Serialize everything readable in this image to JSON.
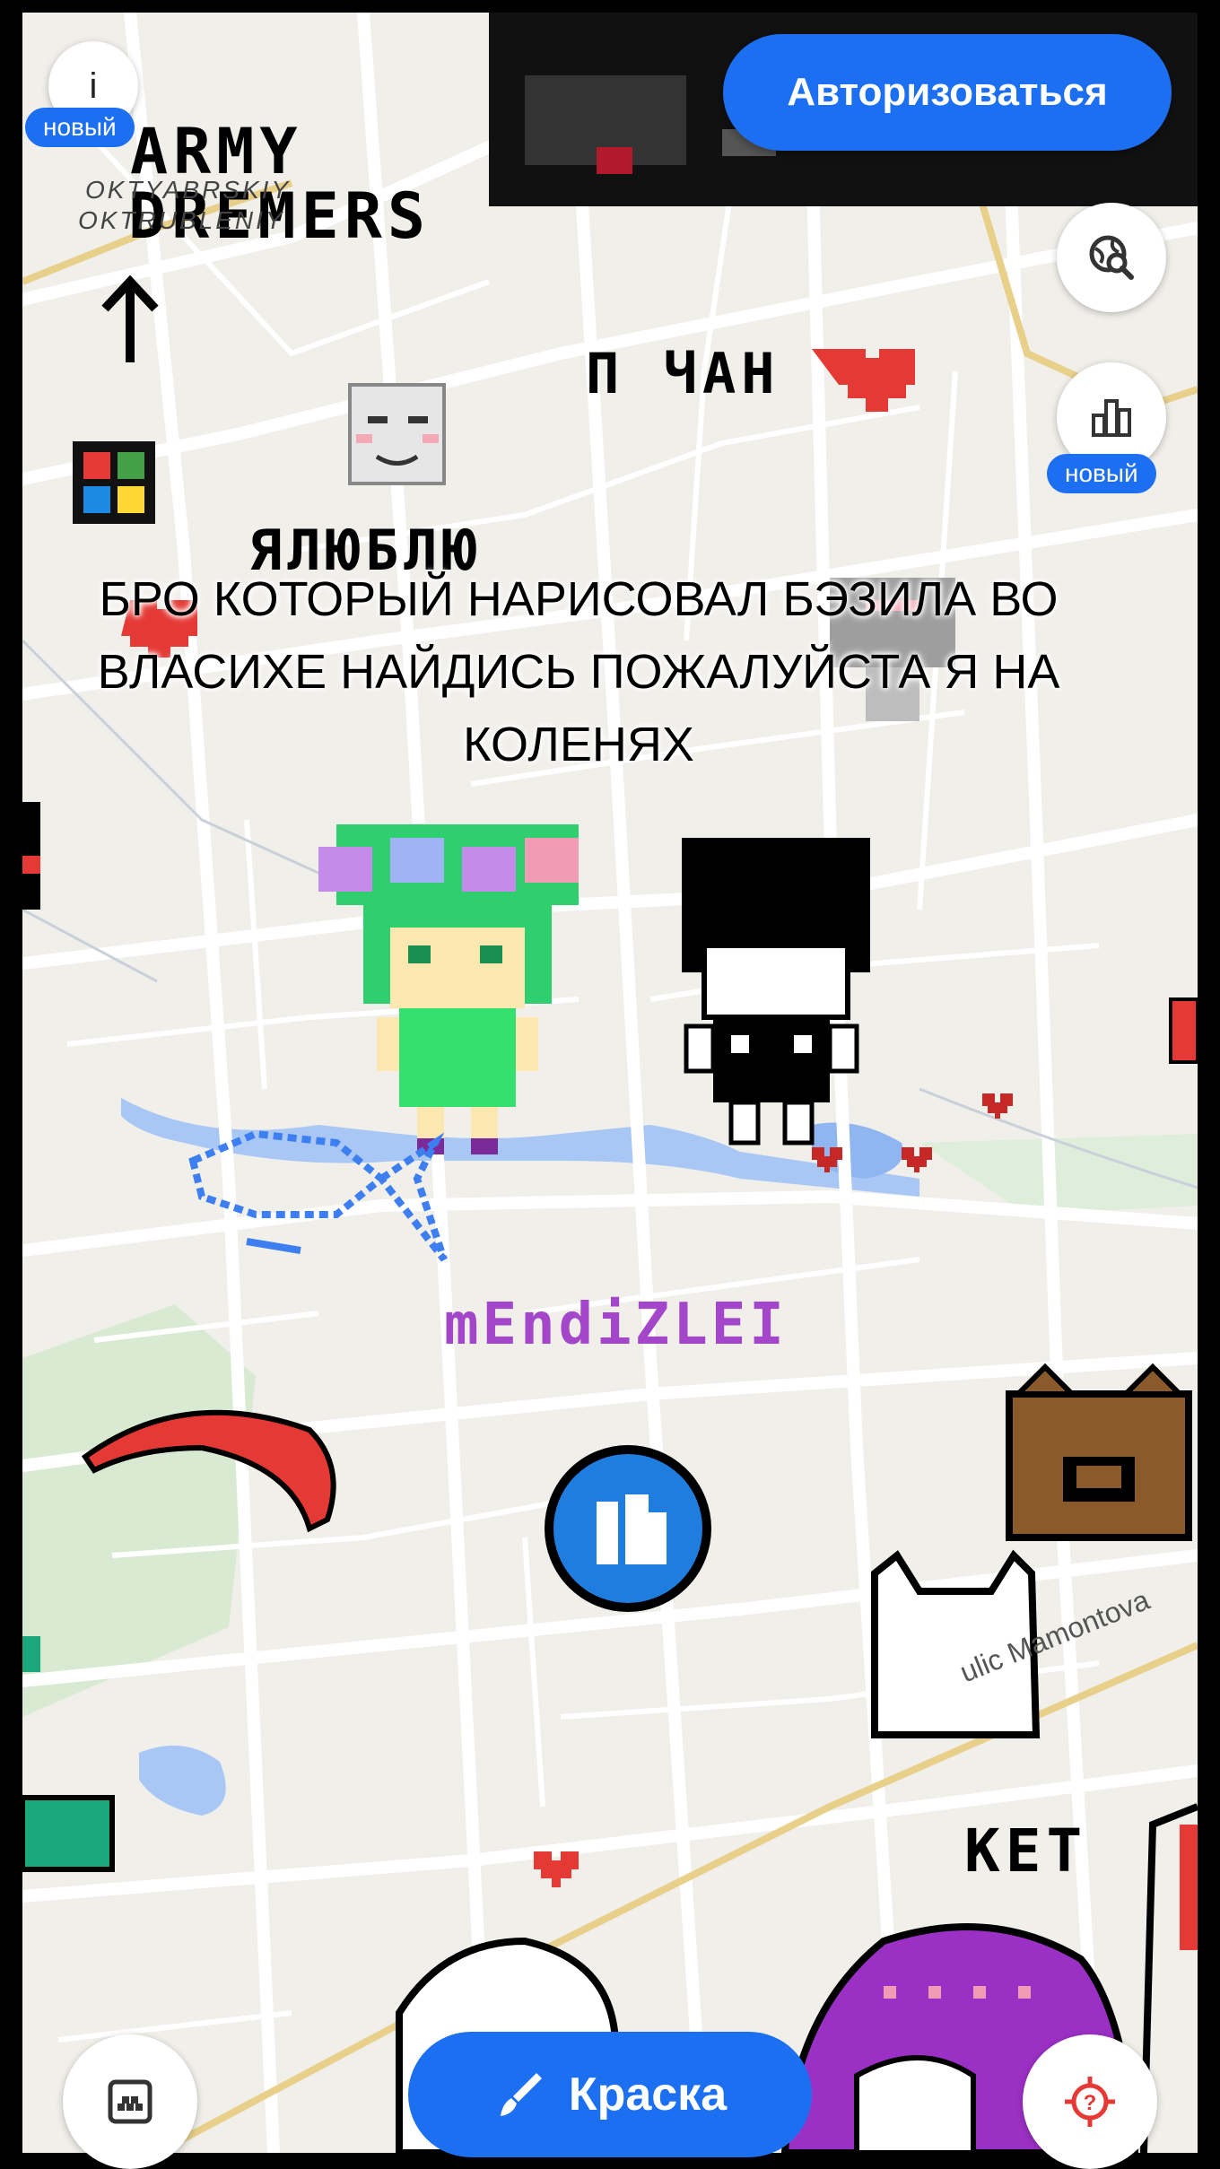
{
  "header": {
    "info_label": "i",
    "info_badge": "новый",
    "auth_button": "Авторизоваться"
  },
  "right_controls": {
    "leaderboard_badge": "новый"
  },
  "map_labels": {
    "district_1": "OKTYABRSKIY",
    "district_2": "OKTRUBLENIY",
    "street": "ulic Mamontova"
  },
  "pixel_art_text": {
    "army": "ARMY",
    "dremers": "DREMERS",
    "pchan": "П ЧАН",
    "yalublu": "ЯЛЮБЛЮ",
    "mendizlei": "mEndiZLEI",
    "ket": "KET"
  },
  "caption": "БРО КОТОРЫЙ НАРИСОВАЛ БЭЗИЛА ВО ВЛАСИХЕ НАЙДИСЬ ПОЖАЛУЙСТА Я НА КОЛЕНЯХ",
  "bottom_bar": {
    "paint_button": "Краска"
  },
  "colors": {
    "accent": "#1d6ff2",
    "map_bg": "#f1efea",
    "road": "#ffffff",
    "water": "#a9c7f5",
    "park": "#d9ead2"
  }
}
